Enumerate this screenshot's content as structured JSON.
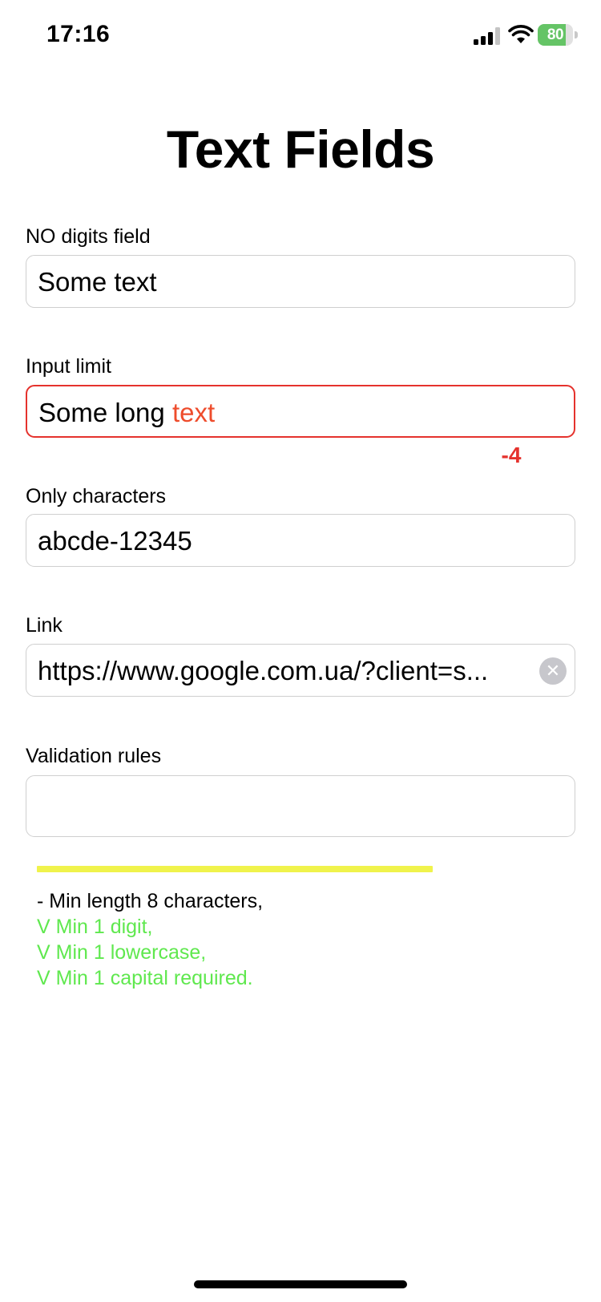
{
  "status_bar": {
    "time": "17:16",
    "battery_percent": "80",
    "battery_level": 0.8,
    "battery_color": "#65c466",
    "icons": [
      "cellular-signal-icon",
      "wifi-icon",
      "battery-charging-icon"
    ]
  },
  "page": {
    "title": "Text Fields"
  },
  "fields": {
    "no_digits": {
      "label": "NO digits field",
      "value": "Some text"
    },
    "input_limit": {
      "label": "Input limit",
      "value_within": "Some long ",
      "value_over": "text",
      "counter": "-4",
      "error_color": "#e5322d"
    },
    "only_characters": {
      "label": "Only characters",
      "value": "abcde-12345"
    },
    "link": {
      "label": "Link",
      "value": "https://www.google.com.ua/?client=s...",
      "clear_icon": "clear-circle-x-icon"
    },
    "validation": {
      "label": "Validation rules",
      "value": "",
      "strength_level": 0.72,
      "strength_color": "#f0f34c",
      "rules": [
        {
          "text": "- Min length 8 characters,",
          "passed": false
        },
        {
          "text": "V Min 1 digit,",
          "passed": true
        },
        {
          "text": "V Min 1 lowercase,",
          "passed": true
        },
        {
          "text": "V Min 1 capital required.",
          "passed": true
        }
      ],
      "pass_color": "#5fe84e"
    }
  }
}
